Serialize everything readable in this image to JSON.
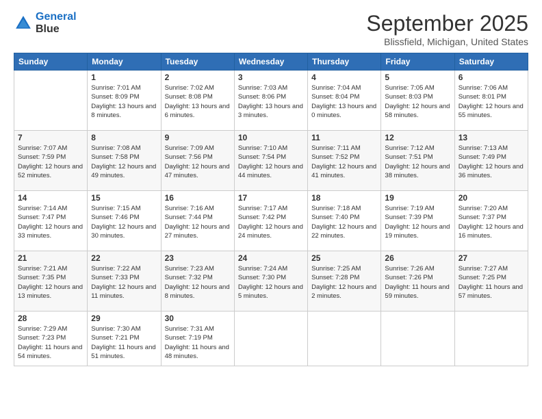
{
  "logo": {
    "line1": "General",
    "line2": "Blue"
  },
  "title": "September 2025",
  "location": "Blissfield, Michigan, United States",
  "days_header": [
    "Sunday",
    "Monday",
    "Tuesday",
    "Wednesday",
    "Thursday",
    "Friday",
    "Saturday"
  ],
  "weeks": [
    [
      {
        "num": "",
        "sunrise": "",
        "sunset": "",
        "daylight": ""
      },
      {
        "num": "1",
        "sunrise": "Sunrise: 7:01 AM",
        "sunset": "Sunset: 8:09 PM",
        "daylight": "Daylight: 13 hours and 8 minutes."
      },
      {
        "num": "2",
        "sunrise": "Sunrise: 7:02 AM",
        "sunset": "Sunset: 8:08 PM",
        "daylight": "Daylight: 13 hours and 6 minutes."
      },
      {
        "num": "3",
        "sunrise": "Sunrise: 7:03 AM",
        "sunset": "Sunset: 8:06 PM",
        "daylight": "Daylight: 13 hours and 3 minutes."
      },
      {
        "num": "4",
        "sunrise": "Sunrise: 7:04 AM",
        "sunset": "Sunset: 8:04 PM",
        "daylight": "Daylight: 13 hours and 0 minutes."
      },
      {
        "num": "5",
        "sunrise": "Sunrise: 7:05 AM",
        "sunset": "Sunset: 8:03 PM",
        "daylight": "Daylight: 12 hours and 58 minutes."
      },
      {
        "num": "6",
        "sunrise": "Sunrise: 7:06 AM",
        "sunset": "Sunset: 8:01 PM",
        "daylight": "Daylight: 12 hours and 55 minutes."
      }
    ],
    [
      {
        "num": "7",
        "sunrise": "Sunrise: 7:07 AM",
        "sunset": "Sunset: 7:59 PM",
        "daylight": "Daylight: 12 hours and 52 minutes."
      },
      {
        "num": "8",
        "sunrise": "Sunrise: 7:08 AM",
        "sunset": "Sunset: 7:58 PM",
        "daylight": "Daylight: 12 hours and 49 minutes."
      },
      {
        "num": "9",
        "sunrise": "Sunrise: 7:09 AM",
        "sunset": "Sunset: 7:56 PM",
        "daylight": "Daylight: 12 hours and 47 minutes."
      },
      {
        "num": "10",
        "sunrise": "Sunrise: 7:10 AM",
        "sunset": "Sunset: 7:54 PM",
        "daylight": "Daylight: 12 hours and 44 minutes."
      },
      {
        "num": "11",
        "sunrise": "Sunrise: 7:11 AM",
        "sunset": "Sunset: 7:52 PM",
        "daylight": "Daylight: 12 hours and 41 minutes."
      },
      {
        "num": "12",
        "sunrise": "Sunrise: 7:12 AM",
        "sunset": "Sunset: 7:51 PM",
        "daylight": "Daylight: 12 hours and 38 minutes."
      },
      {
        "num": "13",
        "sunrise": "Sunrise: 7:13 AM",
        "sunset": "Sunset: 7:49 PM",
        "daylight": "Daylight: 12 hours and 36 minutes."
      }
    ],
    [
      {
        "num": "14",
        "sunrise": "Sunrise: 7:14 AM",
        "sunset": "Sunset: 7:47 PM",
        "daylight": "Daylight: 12 hours and 33 minutes."
      },
      {
        "num": "15",
        "sunrise": "Sunrise: 7:15 AM",
        "sunset": "Sunset: 7:46 PM",
        "daylight": "Daylight: 12 hours and 30 minutes."
      },
      {
        "num": "16",
        "sunrise": "Sunrise: 7:16 AM",
        "sunset": "Sunset: 7:44 PM",
        "daylight": "Daylight: 12 hours and 27 minutes."
      },
      {
        "num": "17",
        "sunrise": "Sunrise: 7:17 AM",
        "sunset": "Sunset: 7:42 PM",
        "daylight": "Daylight: 12 hours and 24 minutes."
      },
      {
        "num": "18",
        "sunrise": "Sunrise: 7:18 AM",
        "sunset": "Sunset: 7:40 PM",
        "daylight": "Daylight: 12 hours and 22 minutes."
      },
      {
        "num": "19",
        "sunrise": "Sunrise: 7:19 AM",
        "sunset": "Sunset: 7:39 PM",
        "daylight": "Daylight: 12 hours and 19 minutes."
      },
      {
        "num": "20",
        "sunrise": "Sunrise: 7:20 AM",
        "sunset": "Sunset: 7:37 PM",
        "daylight": "Daylight: 12 hours and 16 minutes."
      }
    ],
    [
      {
        "num": "21",
        "sunrise": "Sunrise: 7:21 AM",
        "sunset": "Sunset: 7:35 PM",
        "daylight": "Daylight: 12 hours and 13 minutes."
      },
      {
        "num": "22",
        "sunrise": "Sunrise: 7:22 AM",
        "sunset": "Sunset: 7:33 PM",
        "daylight": "Daylight: 12 hours and 11 minutes."
      },
      {
        "num": "23",
        "sunrise": "Sunrise: 7:23 AM",
        "sunset": "Sunset: 7:32 PM",
        "daylight": "Daylight: 12 hours and 8 minutes."
      },
      {
        "num": "24",
        "sunrise": "Sunrise: 7:24 AM",
        "sunset": "Sunset: 7:30 PM",
        "daylight": "Daylight: 12 hours and 5 minutes."
      },
      {
        "num": "25",
        "sunrise": "Sunrise: 7:25 AM",
        "sunset": "Sunset: 7:28 PM",
        "daylight": "Daylight: 12 hours and 2 minutes."
      },
      {
        "num": "26",
        "sunrise": "Sunrise: 7:26 AM",
        "sunset": "Sunset: 7:26 PM",
        "daylight": "Daylight: 11 hours and 59 minutes."
      },
      {
        "num": "27",
        "sunrise": "Sunrise: 7:27 AM",
        "sunset": "Sunset: 7:25 PM",
        "daylight": "Daylight: 11 hours and 57 minutes."
      }
    ],
    [
      {
        "num": "28",
        "sunrise": "Sunrise: 7:29 AM",
        "sunset": "Sunset: 7:23 PM",
        "daylight": "Daylight: 11 hours and 54 minutes."
      },
      {
        "num": "29",
        "sunrise": "Sunrise: 7:30 AM",
        "sunset": "Sunset: 7:21 PM",
        "daylight": "Daylight: 11 hours and 51 minutes."
      },
      {
        "num": "30",
        "sunrise": "Sunrise: 7:31 AM",
        "sunset": "Sunset: 7:19 PM",
        "daylight": "Daylight: 11 hours and 48 minutes."
      },
      {
        "num": "",
        "sunrise": "",
        "sunset": "",
        "daylight": ""
      },
      {
        "num": "",
        "sunrise": "",
        "sunset": "",
        "daylight": ""
      },
      {
        "num": "",
        "sunrise": "",
        "sunset": "",
        "daylight": ""
      },
      {
        "num": "",
        "sunrise": "",
        "sunset": "",
        "daylight": ""
      }
    ]
  ]
}
